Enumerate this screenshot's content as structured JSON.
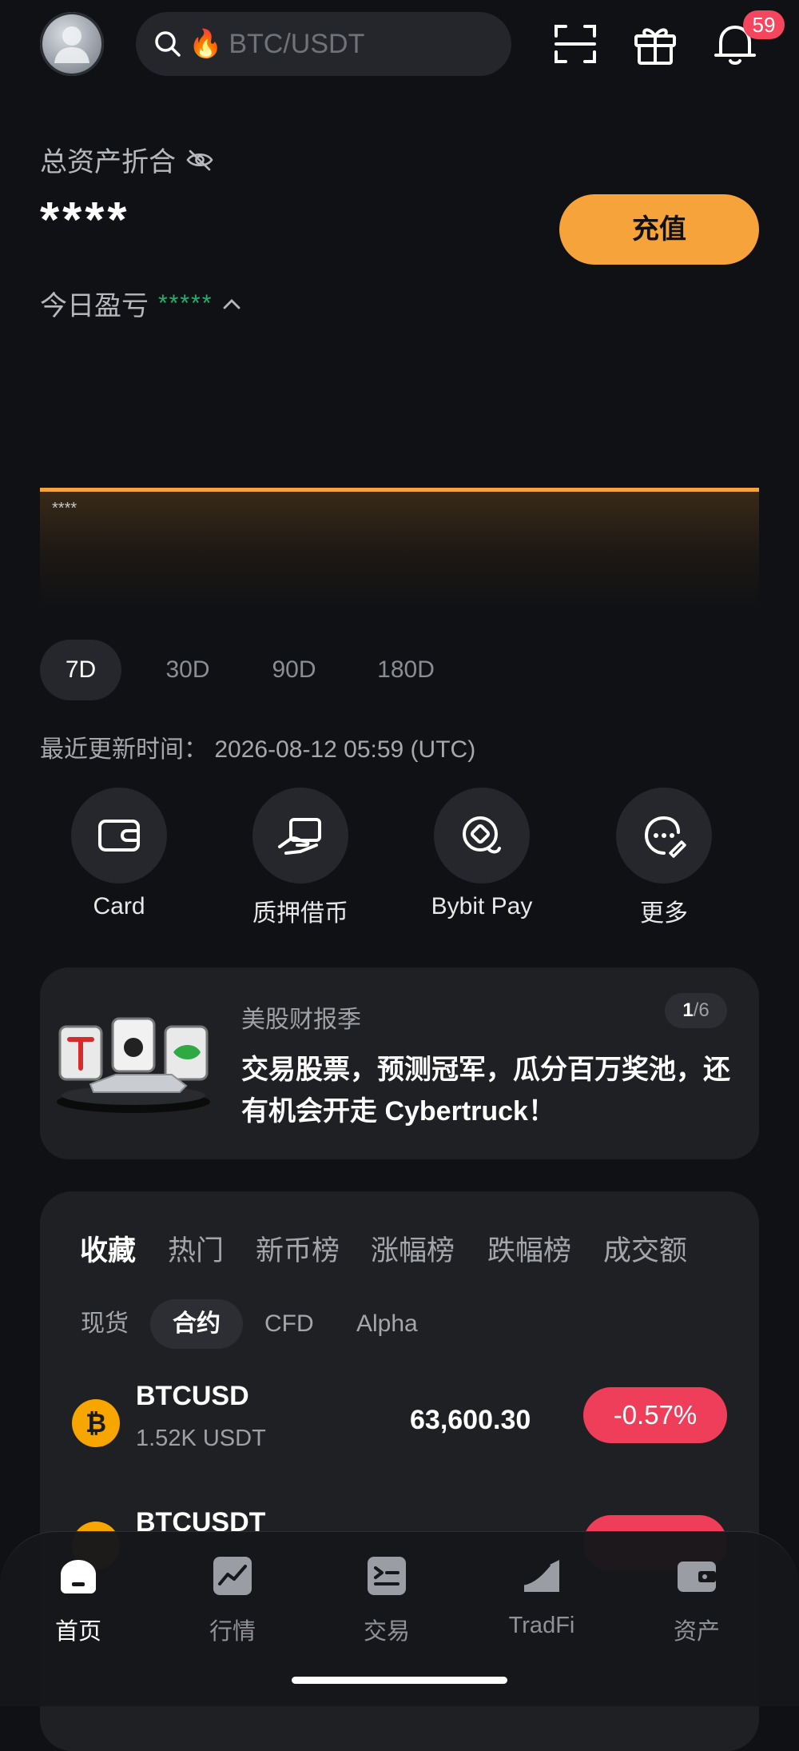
{
  "header": {
    "search_placeholder": "BTC/USDT",
    "search_emoji": "🔥",
    "notification_count": "59"
  },
  "assets": {
    "label": "总资产折合",
    "value": "****",
    "deposit_label": "充值",
    "pnl_label": "今日盈亏",
    "pnl_value": "*****",
    "chart_mask": "****",
    "periods": [
      "7D",
      "30D",
      "90D",
      "180D"
    ],
    "active_period": "7D",
    "updated_label": "最近更新时间：",
    "updated_value": "2026-08-12 05:59 (UTC)"
  },
  "quick_actions": [
    {
      "label": "Card",
      "icon": "wallet-icon"
    },
    {
      "label": "质押借币",
      "icon": "loan-hand-icon"
    },
    {
      "label": "Bybit Pay",
      "icon": "pay-icon"
    },
    {
      "label": "更多",
      "icon": "more-icon"
    }
  ],
  "banner": {
    "category": "美股财报季",
    "title": "交易股票，预测冠军，瓜分百万奖池，还有机会开走 Cybertruck！",
    "page_current": "1",
    "page_total": "/6"
  },
  "market": {
    "tabs": [
      "收藏",
      "热门",
      "新币榜",
      "涨幅榜",
      "跌幅榜",
      "成交额"
    ],
    "active_tab": "收藏",
    "sub_tabs": [
      "现货",
      "合约",
      "CFD",
      "Alpha"
    ],
    "active_sub_tab": "合约",
    "rows": [
      {
        "symbol": "BTCUSD",
        "volume": "1.52K USDT",
        "price": "63,600.30",
        "change": "-0.57%",
        "icon_glyph": "₿"
      },
      {
        "symbol": "BTCUSDT",
        "volume": "",
        "price": "",
        "change": "",
        "icon_glyph": ""
      }
    ]
  },
  "nav": {
    "items": [
      {
        "label": "首页",
        "icon": "home-icon"
      },
      {
        "label": "行情",
        "icon": "market-chart-icon"
      },
      {
        "label": "交易",
        "icon": "trade-icon"
      },
      {
        "label": "TradFi",
        "icon": "tradfi-icon"
      },
      {
        "label": "资产",
        "icon": "asset-wallet-icon"
      }
    ],
    "active": "首页"
  },
  "colors": {
    "accent": "#f7a33b",
    "positive": "#20b26c",
    "negative": "#ef3e5a",
    "background": "#101114"
  }
}
